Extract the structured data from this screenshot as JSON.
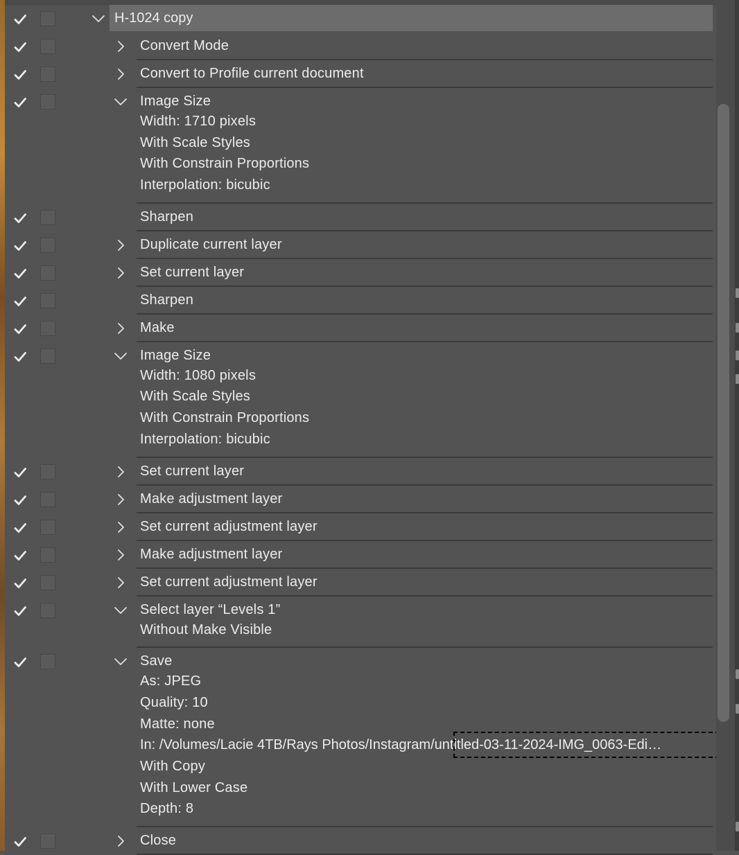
{
  "action_name": "H-1024 copy",
  "steps": [
    {
      "label": "Convert Mode",
      "chevron": "right",
      "details": []
    },
    {
      "label": "Convert to Profile current document",
      "chevron": "right",
      "details": []
    },
    {
      "label": "Image Size",
      "chevron": "down",
      "details": [
        "Width: 1710 pixels",
        "With Scale Styles",
        "With Constrain Proportions",
        "Interpolation: bicubic"
      ]
    },
    {
      "label": "Sharpen",
      "chevron": "none",
      "details": []
    },
    {
      "label": "Duplicate current layer",
      "chevron": "right",
      "details": []
    },
    {
      "label": "Set current layer",
      "chevron": "right",
      "details": []
    },
    {
      "label": "Sharpen",
      "chevron": "none",
      "details": []
    },
    {
      "label": "Make",
      "chevron": "right",
      "details": []
    },
    {
      "label": "Image Size",
      "chevron": "down",
      "details": [
        "Width: 1080 pixels",
        "With Scale Styles",
        "With Constrain Proportions",
        "Interpolation: bicubic"
      ]
    },
    {
      "label": "Set current layer",
      "chevron": "right",
      "details": []
    },
    {
      "label": "Make adjustment layer",
      "chevron": "right",
      "details": []
    },
    {
      "label": "Set current adjustment layer",
      "chevron": "right",
      "details": []
    },
    {
      "label": "Make adjustment layer",
      "chevron": "right",
      "details": []
    },
    {
      "label": "Set current adjustment layer",
      "chevron": "right",
      "details": []
    },
    {
      "label": "Select layer “Levels 1”",
      "chevron": "down",
      "details": [
        "Without Make Visible"
      ]
    },
    {
      "label": "Save",
      "chevron": "down",
      "details": [
        "As: JPEG",
        "Quality: 10",
        "Matte: none",
        "In: /Volumes/Lacie 4TB/Rays Photos/Instagram/untitled-03-11-2024-IMG_0063-Edi…",
        "With Copy",
        "With Lower Case",
        "Depth: 8"
      ]
    },
    {
      "label": "Close",
      "chevron": "right",
      "details": []
    }
  ]
}
